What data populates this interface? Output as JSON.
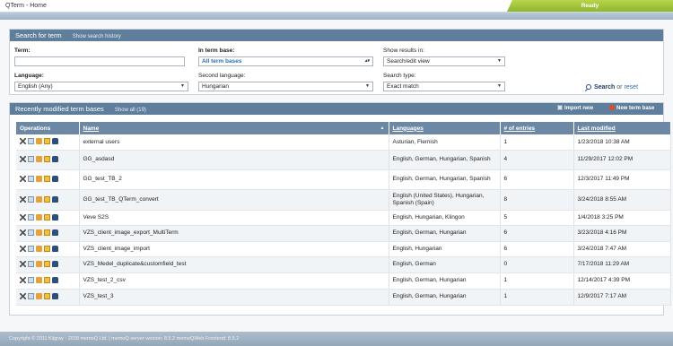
{
  "window": {
    "title": "QTerm - Home",
    "status": "Ready"
  },
  "search": {
    "header": "Search for term",
    "history_link": "Show search history",
    "term_label": "Term:",
    "term_value": "",
    "termbase_label": "In term base:",
    "termbase_value": "All term bases",
    "show_results_label": "Show results in:",
    "show_results_value": "Search/edit view",
    "language_label": "Language:",
    "language_value": "English (Any)",
    "second_language_label": "Second language:",
    "second_language_value": "Hungarian",
    "search_type_label": "Search type:",
    "search_type_value": "Exact match",
    "search_button": "Search",
    "or_text": "or",
    "reset_link": "reset"
  },
  "recent": {
    "header": "Recently modified term bases",
    "show_all": "Show all (19)",
    "import_new": "Import new",
    "new_term_base": "New term base",
    "columns": [
      "Operations",
      "Name",
      "Languages",
      "# of entries",
      "Last modified"
    ],
    "rows": [
      {
        "name": "external users",
        "languages": "Asturian, Flemish",
        "entries": "1",
        "modified": "1/23/2018 10:38 AM"
      },
      {
        "name": "GG_asdasd",
        "languages": "English, German, Hungarian, Spanish",
        "entries": "4",
        "modified": "11/29/2017 12:02 PM"
      },
      {
        "name": "GG_test_TB_2",
        "languages": "English, German, Hungarian, Spanish",
        "entries": "6",
        "modified": "12/3/2017 11:49 PM"
      },
      {
        "name": "GG_test_TB_QTerm_convert",
        "languages": "English (United States), Hungarian, Spanish (Spain)",
        "entries": "8",
        "modified": "3/24/2018 8:55 AM"
      },
      {
        "name": "Veve S2S",
        "languages": "English, Hungarian, Klingon",
        "entries": "5",
        "modified": "1/4/2018 3:25 PM"
      },
      {
        "name": "VZS_client_image_export_MultiTerm",
        "languages": "English, German, Hungarian",
        "entries": "6",
        "modified": "3/23/2018 4:16 PM"
      },
      {
        "name": "VZS_client_image_import",
        "languages": "English, Hungarian",
        "entries": "6",
        "modified": "3/24/2018 7:47 AM"
      },
      {
        "name": "VZS_Medel_duplicate&customfield_test",
        "languages": "English, German",
        "entries": "0",
        "modified": "7/17/2018 11:29 AM"
      },
      {
        "name": "VZS_test_2_csv",
        "languages": "English, German, Hungarian",
        "entries": "1",
        "modified": "12/14/2017 4:39 PM"
      },
      {
        "name": "VZS_test_3",
        "languages": "English, German, Hungarian",
        "entries": "1",
        "modified": "12/9/2017 7:17 AM"
      }
    ]
  },
  "footer": {
    "text": "Copyright © 2011 Kilgray · 2018 memoQ Ltd. | memoQ server version: 8.5.2 memoQWeb Frontend: 8.5.2"
  },
  "colors": {
    "panel_header": "#5e7e9c",
    "table_header": "#6d88a4",
    "status_green": "#9cc23a",
    "link_blue": "#2d6fad"
  }
}
